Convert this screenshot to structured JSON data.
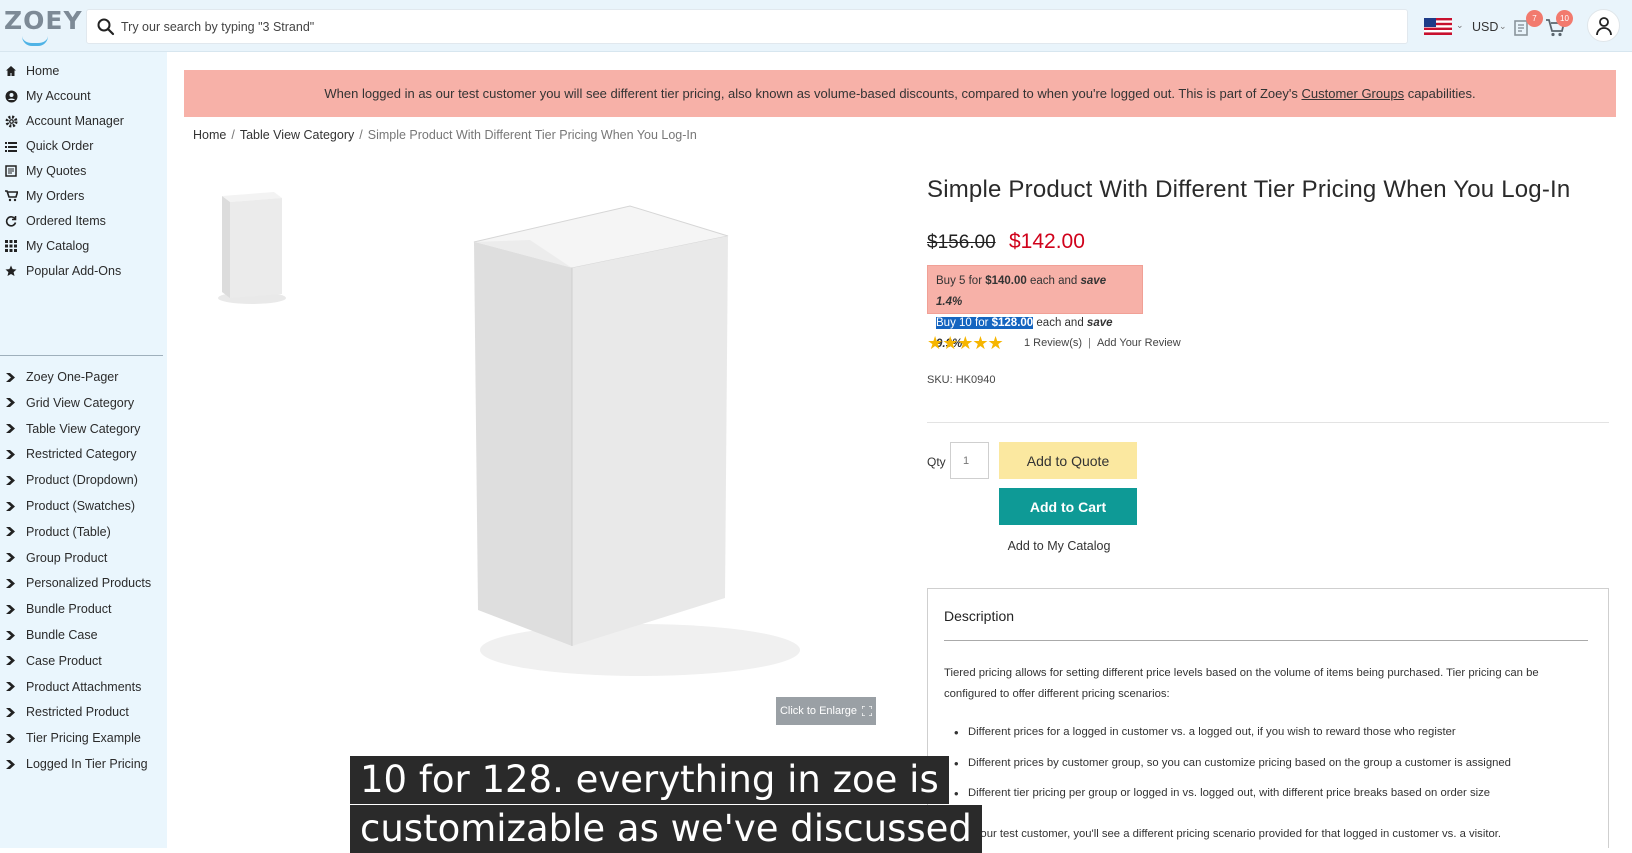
{
  "header": {
    "logo_text": "ZOEY",
    "search_placeholder": "Try our search by typing \"3 Strand\"",
    "currency": "USD",
    "quote_badge": "7",
    "cart_badge": "10"
  },
  "sidebar": {
    "items": [
      {
        "label": "Home",
        "icon": "home-icon"
      },
      {
        "label": "My Account",
        "icon": "account-circle-icon"
      },
      {
        "label": "Account Manager",
        "icon": "gear-icon"
      },
      {
        "label": "Quick Order",
        "icon": "list-icon"
      },
      {
        "label": "My Quotes",
        "icon": "quotes-icon"
      },
      {
        "label": "My Orders",
        "icon": "cart-icon"
      },
      {
        "label": "Ordered Items",
        "icon": "refresh-icon"
      },
      {
        "label": "My Catalog",
        "icon": "grid-icon"
      },
      {
        "label": "Popular Add-Ons",
        "icon": "star-icon"
      }
    ],
    "categories": [
      "Zoey One-Pager",
      "Grid View Category",
      "Table View Category",
      "Restricted Category",
      "Product (Dropdown)",
      "Product (Swatches)",
      "Product (Table)",
      "Group Product",
      "Personalized Products",
      "Bundle Product",
      "Bundle Case",
      "Case Product",
      "Product Attachments",
      "Restricted Product",
      "Tier Pricing Example",
      "Logged In Tier Pricing"
    ]
  },
  "banner": {
    "text": "When logged in as our test customer you will see different tier pricing, also known as volume-based discounts, compared to when you're logged out. This is part of Zoey's ",
    "link": "Customer Groups",
    "suffix": " capabilities."
  },
  "breadcrumb": {
    "home": "Home",
    "category": "Table View Category",
    "current": "Simple Product With Different Tier Pricing When You Log-In",
    "separator": "/"
  },
  "gallery": {
    "enlarge_label": "Click to Enlarge"
  },
  "product": {
    "title": "Simple Product With Different Tier Pricing When You Log-In",
    "old_price": "$156.00",
    "price": "$142.00",
    "tiers": [
      {
        "prefix": "Buy 5 for ",
        "price": "$140.00",
        "mid": " each and ",
        "save": "save 1.4%"
      },
      {
        "prefix": "Buy 10 for ",
        "price": "$128.00",
        "mid": " each and ",
        "save": "save 9.9%"
      }
    ],
    "rating": 5,
    "stars": "★★★★★",
    "reviews_label": "1 Review(s)",
    "review_sep": "|",
    "add_review_label": "Add Your Review",
    "sku": "SKU:  HK0940",
    "qty_label": "Qty",
    "qty_value": "1",
    "add_to_quote": "Add to Quote",
    "add_to_cart": "Add to Cart",
    "add_to_catalog": "Add to My Catalog"
  },
  "description": {
    "title": "Description",
    "paragraph": "Tiered pricing allows for setting different price levels based on the volume of items being purchased. Tier pricing can be configured to offer different pricing scenarios:",
    "bullets": [
      "Different prices for a logged in customer vs. a logged out, if you wish to reward those who register",
      "Different prices by customer group, so you can customize pricing based on the group a customer is assigned",
      "Different tier pricing per group or logged in vs. logged out, with different price breaks based on order size"
    ],
    "partial_line": "g in as our test customer, you'll see a different pricing scenario provided for that logged in customer vs. a visitor."
  },
  "captions": {
    "line1": "10 for 128. everything in zoe is",
    "line2": "customizable as we've discussed"
  },
  "colors": {
    "banner_bg": "#f7b1a8",
    "price_red": "#d0021b",
    "cart_teal": "#0e9a96",
    "quote_yellow": "#fbe8a0",
    "sidebar_bg": "#eaf6fd"
  }
}
